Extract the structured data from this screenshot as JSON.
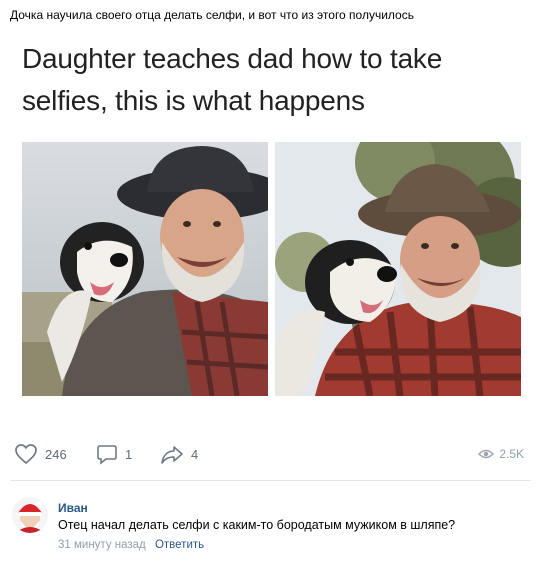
{
  "post": {
    "text": "Дочка научила своего отца делать селфи, и вот что из этого получилось",
    "meme_title_line1": "Daughter teaches dad how to take",
    "meme_title_line2": "selfies, this is what happens"
  },
  "actions": {
    "likes": "246",
    "comments": "1",
    "shares": "4",
    "views": "2.5K"
  },
  "comment": {
    "author": "Иван",
    "text": "Отец начал делать селфи с каким-то бородатым мужиком в шляпе?",
    "time": "31 минуту назад",
    "reply_label": "Ответить"
  },
  "colors": {
    "link": "#2a5885",
    "icon": "#6f7985",
    "muted": "#939ea9"
  },
  "icons": [
    "heart-icon",
    "comment-icon",
    "share-icon",
    "eye-icon"
  ]
}
